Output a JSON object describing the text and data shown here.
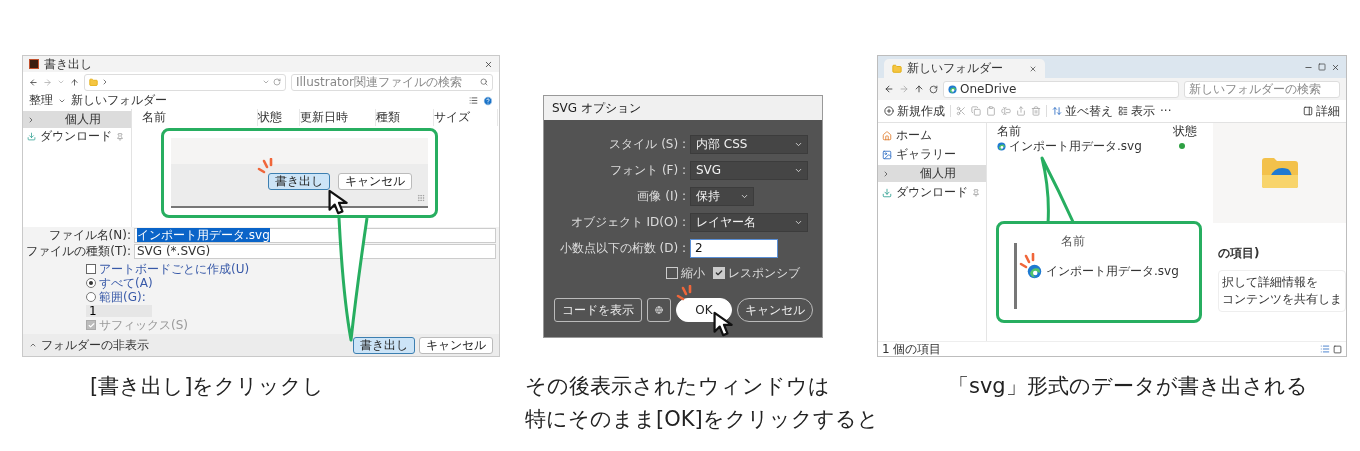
{
  "export_dialog": {
    "title": "書き出し",
    "search_placeholder": "Illustrator関連ファイルの検索",
    "organize": "整理",
    "new_folder": "新しいフォルダー",
    "sidebar": [
      {
        "label": "個人用",
        "kind": "folder",
        "selected": true
      },
      {
        "label": "ダウンロード",
        "kind": "download",
        "selected": false
      }
    ],
    "columns": [
      "名前",
      "状態",
      "更新日時",
      "種類",
      "サイズ"
    ],
    "fields": [
      {
        "label": "ファイル名(N):",
        "value": "インポート用データ.svg",
        "selected": true
      },
      {
        "label": "ファイルの種類(T):",
        "value": "SVG (*.SVG)",
        "selected": false
      }
    ],
    "options": [
      {
        "kind": "checkbox",
        "label": "アートボードごとに作成(U)",
        "checked": false,
        "disabled": false
      },
      {
        "kind": "radio",
        "label": "すべて(A)",
        "selected": true
      },
      {
        "kind": "radio",
        "label": "範囲(G):",
        "selected": false
      },
      {
        "kind": "field",
        "value": "1"
      },
      {
        "kind": "checkbox",
        "label": "サフィックス(S)",
        "checked": true,
        "disabled": true
      }
    ],
    "hide_folders": "フォルダーの非表示",
    "buttons": [
      {
        "label": "書き出し",
        "primary": true
      },
      {
        "label": "キャンセル",
        "primary": false
      }
    ],
    "callout": {
      "buttons": [
        {
          "label": "書き出し",
          "primary": true
        },
        {
          "label": "キャンセル",
          "primary": false
        }
      ]
    },
    "caption": [
      "[書き出し]をクリックし"
    ]
  },
  "svg_options": {
    "title": "SVG オプション",
    "rows": [
      {
        "kind": "select",
        "label": "スタイル (S) :",
        "value": "内部 CSS",
        "wide": true
      },
      {
        "kind": "select",
        "label": "フォント (F) :",
        "value": "SVG",
        "wide": true
      },
      {
        "kind": "select",
        "label": "画像 (I) :",
        "value": "保持",
        "wide": false
      },
      {
        "kind": "select",
        "label": "オブジェクト ID(O) :",
        "value": "レイヤー名",
        "wide": true
      },
      {
        "kind": "input",
        "label": "小数点以下の桁数 (D) :",
        "value": "2"
      }
    ],
    "checkboxes": [
      {
        "label": "縮小",
        "checked": false
      },
      {
        "label": "レスポンシブ",
        "checked": true
      }
    ],
    "buttons": [
      {
        "kind": "plain",
        "label": "コードを表示"
      },
      {
        "kind": "globe"
      },
      {
        "kind": "primary",
        "label": "OK"
      },
      {
        "kind": "pill",
        "label": "キャンセル"
      }
    ],
    "caption": [
      "その後表示されたウィンドウは",
      "特にそのまま[OK]をクリックすると"
    ]
  },
  "explorer": {
    "tab": "新しいフォルダー",
    "address": "OneDrive",
    "search_placeholder": "新しいフォルダーの検索",
    "toolbar": {
      "new": "新規作成",
      "sort": "並べ替え",
      "view": "表示",
      "more": "···",
      "details": "詳細"
    },
    "sidebar": [
      {
        "label": "ホーム",
        "kind": "home",
        "selected": false
      },
      {
        "label": "ギャラリー",
        "kind": "gallery",
        "selected": false
      },
      {
        "label": "個人用",
        "kind": "folder",
        "selected": true
      },
      {
        "label": "ダウンロード",
        "kind": "download",
        "selected": false
      }
    ],
    "columns": [
      "名前",
      "状態"
    ],
    "files": [
      {
        "name": "インポート用データ.svg",
        "synced": true
      }
    ],
    "details_pane": [
      "の項目)",
      "択して詳細情報を",
      "コンテンツを共有しま"
    ],
    "status": "1 個の項目",
    "callout": {
      "column": "名前",
      "file": "インポート用データ.svg"
    },
    "caption": [
      "「svg」形式のデータが書き出される"
    ]
  }
}
